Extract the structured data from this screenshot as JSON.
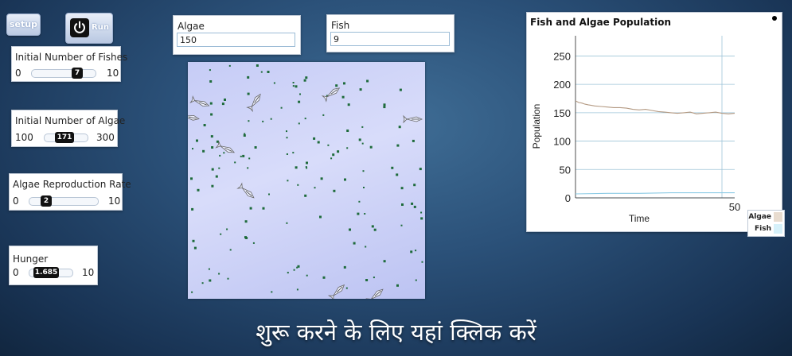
{
  "buttons": {
    "setup": "setup",
    "run": "Run"
  },
  "sliders": [
    {
      "title": "Initial Number of Fishes",
      "min": "0",
      "max": "10",
      "value": "7",
      "fraction": 0.7
    },
    {
      "title": "Initial Number of Algae",
      "min": "100",
      "max": "300",
      "value": "171",
      "fraction": 0.355
    },
    {
      "title": "Algae Reproduction Rate",
      "min": "0",
      "max": "10",
      "value": "2",
      "fraction": 0.2
    },
    {
      "title": "Hunger",
      "min": "0",
      "max": "10",
      "value": "1.685",
      "fraction": 0.1685
    }
  ],
  "monitors": {
    "algae": {
      "label": "Algae",
      "value": "150"
    },
    "fish": {
      "label": "Fish",
      "value": "9"
    }
  },
  "colors": {
    "algae_line": "#b49a83",
    "fish_line": "#8ccbe5",
    "world": "#cfd3f8",
    "algae_patch": "#1e6b3b",
    "grid": "#9ec4d8"
  },
  "chart_data": {
    "type": "line",
    "title": "Fish and Algae Population",
    "xlabel": "Time",
    "ylabel": "Population",
    "xlim": [
      0,
      50
    ],
    "ylim": [
      0,
      280
    ],
    "y_ticks": [
      "0",
      "50",
      "100",
      "150",
      "200",
      "250"
    ],
    "x_tick_label": "50",
    "current_time": 46,
    "series": [
      {
        "name": "Algae",
        "color": "#b49a83",
        "x": [
          0,
          1,
          2,
          3,
          4,
          5,
          6,
          8,
          10,
          12,
          14,
          16,
          18,
          20,
          22,
          24,
          26,
          28,
          30,
          32,
          34,
          36,
          38,
          40,
          42,
          44,
          46,
          48,
          50
        ],
        "values": [
          171,
          168,
          167,
          165,
          164,
          163,
          162,
          161,
          160,
          159,
          159,
          158,
          156,
          155,
          156,
          154,
          152,
          151,
          150,
          149,
          150,
          151,
          148,
          149,
          150,
          151,
          149,
          148,
          149
        ]
      },
      {
        "name": "Fish",
        "color": "#8ccbe5",
        "x": [
          0,
          10,
          20,
          30,
          40,
          46,
          50
        ],
        "values": [
          7,
          8,
          8,
          9,
          9,
          9,
          9
        ]
      }
    ],
    "grid": true
  },
  "legend": {
    "algae": "Algae",
    "fish": "Fish"
  },
  "cta": "शुरू करने के लिए यहां क्लिक करें"
}
